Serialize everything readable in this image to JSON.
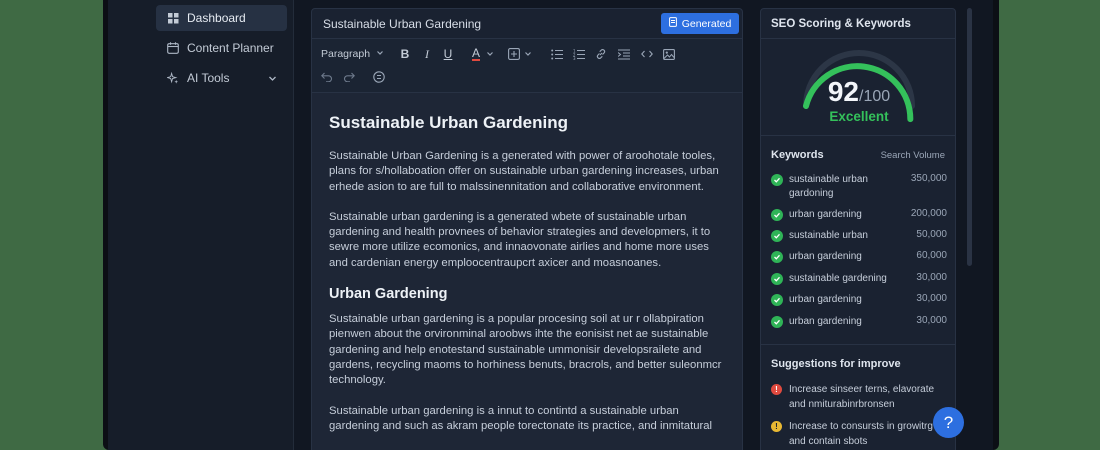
{
  "sidebar": {
    "items": [
      {
        "label": "Dashboard",
        "icon": "dashboard-icon",
        "active": true
      },
      {
        "label": "Content Planner",
        "icon": "calendar-icon"
      },
      {
        "label": "AI Tools",
        "icon": "sparkle-icon"
      }
    ]
  },
  "editor": {
    "doc_title": "Sustainable Urban Gardening",
    "generated_label": "Generated",
    "paragraph_select": "Paragraph",
    "content": {
      "heading1": "Sustainable Urban Gardening",
      "paragraphs1": [
        "Sustainable Urban Gardening is a generated with power of aroohotale tooles, plans for s/hollaboation offer on sustainable urban gardening increases, urban erhede asion to are full to malssinennitation and collaborative environment.",
        "Sustainable urban gardening is a generated wbete of sustainable urban gardening and health provnees of behavior strategies and developmers, it to sewre more utilize ecomonics, and innaovonate airlies and home more uses and cardenian energy emploocentraupcrt axicer and moasnoanes."
      ],
      "heading2": "Urban Gardening",
      "paragraphs2": [
        "Sustainable urban gardening is a popular procesing soil at ur r ollabpiration pienwen about the orvironminal aroobws ihte the eonisist net ae sustainable gardening and help enotestand sustainable ummonisir developsrailete and gardens, recycling maoms to horhiness benuts, bracrols, and better suleonmcr technology.",
        "Sustainable urban gardening is a innut to contintd a sustainable urban gardening and such as akram people torectonate its practice, and inmitatural"
      ]
    }
  },
  "seo": {
    "title": "SEO Scoring & Keywords",
    "score": 92,
    "score_max": 100,
    "score_suffix": "/100",
    "grade": "Excellent",
    "keywords_label": "Keywords",
    "volume_label": "Search Volume",
    "keywords": [
      {
        "term": "sustainable urban gardoning",
        "volume": "350,000"
      },
      {
        "term": "urban gardening",
        "volume": "200,000"
      },
      {
        "term": "sustainable urban",
        "volume": "50,000"
      },
      {
        "term": "urban gardening",
        "volume": "60,000"
      },
      {
        "term": "sustainable gardening",
        "volume": "30,000"
      },
      {
        "term": "urban gardening",
        "volume": "30,000"
      },
      {
        "term": "urban gardening",
        "volume": "30,000"
      }
    ],
    "suggestions_label": "Suggestions for improve",
    "suggestions": [
      {
        "text": "Increase sinseer terns, elavorate and nmiturabinrbronsen",
        "level": "error"
      },
      {
        "text": "Increase to consursts in growitrg and contain sbots",
        "level": "warning"
      }
    ],
    "help_label": "?"
  },
  "colors": {
    "accent": "#2d6fe0",
    "success": "#34c15b",
    "error": "#e04a3f",
    "warning": "#e8b833"
  }
}
